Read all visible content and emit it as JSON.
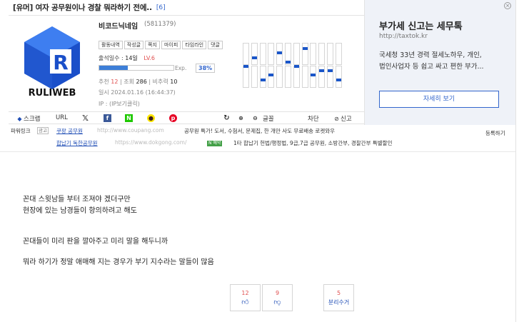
{
  "post": {
    "title": "[유머] 여자 공무원이나 경찰 뭐라하기 전에..",
    "comment_count": "[6]"
  },
  "profile": {
    "logo_text": "RULIWEB",
    "nickname": "비코드닉네임",
    "user_id": "(5811379)",
    "buttons": [
      "활동내역",
      "작성글",
      "쪽지",
      "마이피",
      "타임라인",
      "댓글"
    ],
    "attend_label": "출석일수 :",
    "attend_days": "14일",
    "level": "LV.6",
    "exp_label": "Exp.",
    "exp_percent": "38%",
    "exp_fraction": 0.38,
    "stat_rec_label": "추천",
    "stat_rec_value": "12",
    "stat_view_label": "조회",
    "stat_view_value": "286",
    "stat_nonrec_label": "비추력",
    "stat_nonrec_value": "10",
    "date": "일시 2024.01.16 (16:44:37)",
    "ip": "IP : (IP보기클릭)"
  },
  "toolbar": {
    "scrap": "스크랩",
    "url": "URL",
    "font": "글꼴",
    "block": "차단",
    "report": "신고"
  },
  "links": {
    "label": "파워링크",
    "ad_tag": "광고",
    "item1_title": "쿠팡 공무원",
    "item1_url": "http://www.coupang.com",
    "item1_desc": "공무원 특가! 도서, 수험서, 문제집, 한 개만 사도 무료배송 로켓와우",
    "item2_title": "합납기 독한공무원",
    "item2_url": "https://www.dokgong.com/",
    "item2_tag": "N 예약",
    "item2_desc": "1타 합납기 헌법/행정법, 9급,7급 공무원, 소방간부, 경찰간부 특별할인",
    "register": "등록하기"
  },
  "article": {
    "lines": [
      "꼰대 스윗남들 부터 조져야 겠더구만",
      "현장에 있는 남경들이 항의하려고 해도",
      "꼰대들이 미리 판을 깔아주고 미리 말을 해두니까",
      "뭐라 하기가 정말 애매해 지는 경우가 부기 지수라는 말들이 많음"
    ]
  },
  "votes": {
    "up": "12",
    "down": "9",
    "report_count": "5",
    "report_label": "분리수거"
  },
  "ad": {
    "headline": "부가세 신고는 세무톡",
    "url": "http://taxtok.kr",
    "desc1": "국세청 33년 경력 절세노하우, 개인,",
    "desc2": "법인사업자 등 쉽고 싸고 편한 부가...",
    "button": "자세히 보기"
  },
  "chart_data": {
    "type": "bar",
    "values": [
      0.5,
      0.7,
      0.2,
      0.3,
      0.8,
      0.6,
      0.5,
      0.9,
      0.3,
      0.4,
      0.4,
      0.2
    ]
  }
}
